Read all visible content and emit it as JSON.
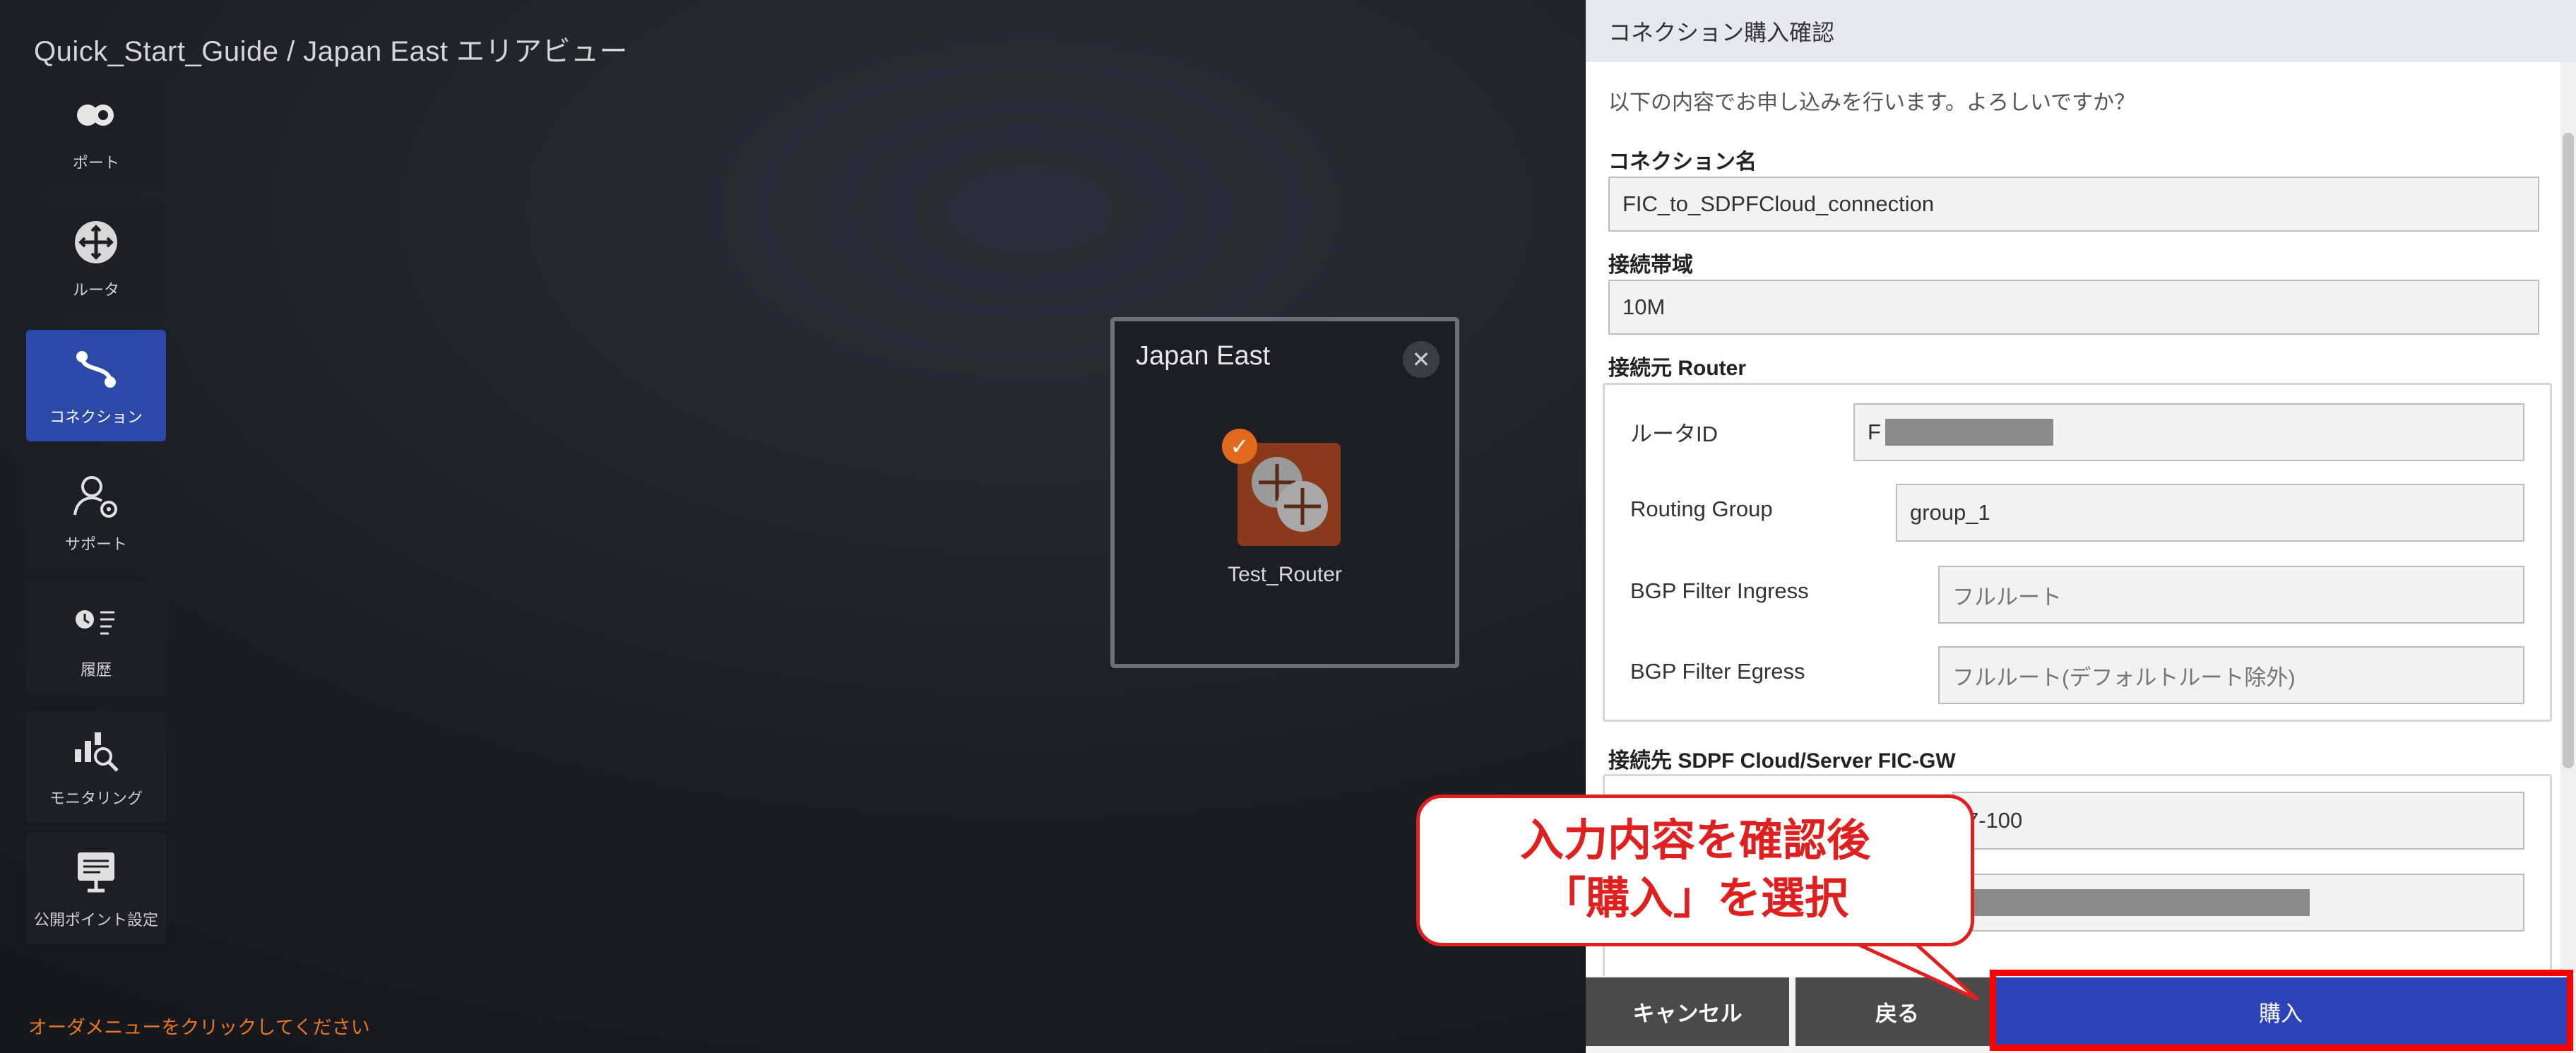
{
  "breadcrumb": "Quick_Start_Guide / Japan East エリアビュー",
  "sidebar": {
    "items": [
      {
        "label": "ポート",
        "icon": "port-icon",
        "active": false
      },
      {
        "label": "ルータ",
        "icon": "router-icon",
        "active": false
      },
      {
        "label": "コネクション",
        "icon": "connection-icon",
        "active": true
      },
      {
        "label": "サポート",
        "icon": "support-icon",
        "active": false
      },
      {
        "label": "履歴",
        "icon": "history-icon",
        "active": false
      },
      {
        "label": "モニタリング",
        "icon": "monitoring-icon",
        "active": false
      },
      {
        "label": "公開ポイント設定",
        "icon": "public-point-icon",
        "active": false
      }
    ],
    "order_hint": "オーダメニューをクリックしてください"
  },
  "area_card": {
    "title": "Japan East",
    "router_label": "Test_Router"
  },
  "panel": {
    "title": "コネクション購入確認",
    "message": "以下の内容でお申し込みを行います。よろしいですか？",
    "connection_name_label": "コネクション名",
    "connection_name_value": "FIC_to_SDPFCloud_connection",
    "bandwidth_label": "接続帯域",
    "bandwidth_value": "10M",
    "source_label": "接続元 Router",
    "source_rows": [
      {
        "label": "ルータID",
        "value": "F"
      },
      {
        "label": "Routing Group",
        "value": "group_1"
      },
      {
        "label": "BGP Filter Ingress",
        "value": "フルルート"
      },
      {
        "label": "BGP Filter Egress",
        "value": "フルルート(デフォルトルート除外)"
      }
    ],
    "dest_label": "接続先 SDPF Cloud/Server FIC-GW",
    "dest_rows": [
      {
        "value": "7-100"
      }
    ]
  },
  "footer": {
    "cancel": "キャンセル",
    "back": "戻る",
    "buy": "購入"
  },
  "callout": {
    "line1": "入力内容を確認後",
    "line2": "「購入」を選択"
  },
  "colors": {
    "accent": "#2d44b8",
    "active_sidebar": "#2d49a8",
    "highlight_red": "#e0201f",
    "router_orange": "#e06a1e"
  }
}
